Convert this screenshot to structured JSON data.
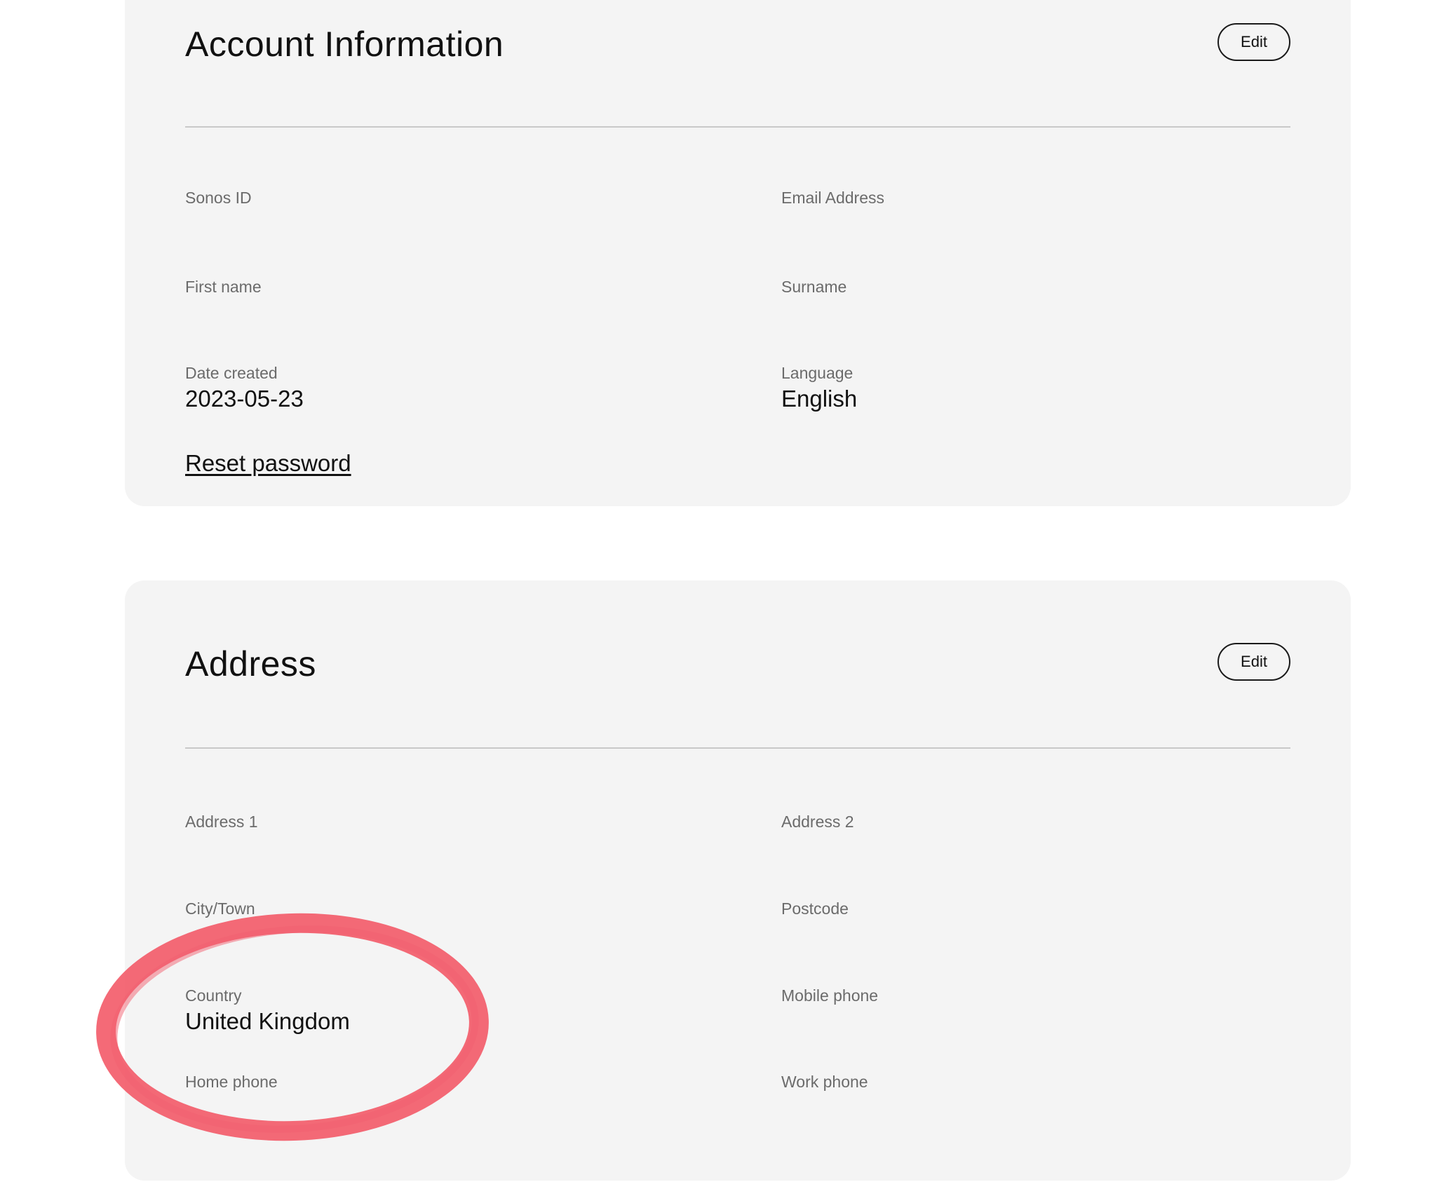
{
  "account": {
    "title": "Account Information",
    "edit_label": "Edit",
    "fields": {
      "sonos_id": {
        "label": "Sonos ID",
        "value": ""
      },
      "email": {
        "label": "Email Address",
        "value": ""
      },
      "first_name": {
        "label": "First name",
        "value": ""
      },
      "surname": {
        "label": "Surname",
        "value": ""
      },
      "date_created": {
        "label": "Date created",
        "value": "2023-05-23"
      },
      "language": {
        "label": "Language",
        "value": "English"
      }
    },
    "reset_password_label": "Reset password"
  },
  "address": {
    "title": "Address",
    "edit_label": "Edit",
    "fields": {
      "address1": {
        "label": "Address 1",
        "value": ""
      },
      "address2": {
        "label": "Address 2",
        "value": ""
      },
      "city": {
        "label": "City/Town",
        "value": ""
      },
      "postcode": {
        "label": "Postcode",
        "value": ""
      },
      "country": {
        "label": "Country",
        "value": "United Kingdom"
      },
      "mobile_phone": {
        "label": "Mobile phone",
        "value": ""
      },
      "home_phone": {
        "label": "Home phone",
        "value": ""
      },
      "work_phone": {
        "label": "Work phone",
        "value": ""
      }
    }
  },
  "colors": {
    "card_background": "#f4f4f4",
    "annotation": "#f2505f"
  }
}
